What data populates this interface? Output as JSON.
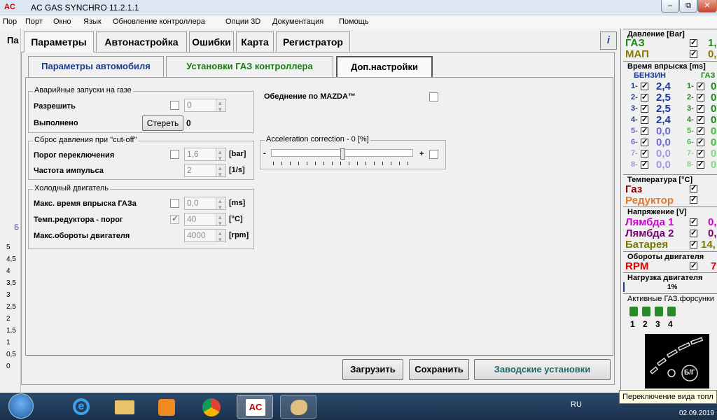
{
  "window": {
    "logo": "AC",
    "title": "AC GAS SYNCHRO  11.2.1.1",
    "controls": [
      "–",
      "⧉",
      "✕"
    ]
  },
  "menu": [
    "Пор",
    "Порт",
    "Окно",
    "Язык",
    "Обновление контроллера",
    "Опции 3D",
    "Документация",
    "Помощь"
  ],
  "left_strip": {
    "cut_label": "Па",
    "b_label": "Б",
    "y_ticks": [
      "5",
      "4,5",
      "4",
      "3,5",
      "3",
      "2,5",
      "2",
      "1,5",
      "1",
      "0,5",
      "0"
    ]
  },
  "tabs": [
    "Параметры",
    "Автонастройка",
    "Ошибки",
    "Карта",
    "Регистратор"
  ],
  "help_icon": "i",
  "subtabs": [
    "Параметры автомобиля",
    "Установки ГАЗ контроллера",
    "Доп.настройки"
  ],
  "groups": {
    "emergency": {
      "title": "Аварийные запуски на газе",
      "allow_label": "Разрешить",
      "allow_value": "0",
      "done_label": "Выполнено",
      "erase_btn": "Стереть",
      "done_value": "0"
    },
    "cutoff": {
      "title": "Сброс давления при \"cut-off\"",
      "threshold_label": "Порог переключения",
      "threshold_value": "1,6",
      "threshold_unit": "[bar]",
      "freq_label": "Частота импульса",
      "freq_value": "2",
      "freq_unit": "[1/s]"
    },
    "cold": {
      "title": "Холодный двигатель",
      "max_inj_label": "Макс. время впрыска ГАЗа",
      "max_inj_value": "0,0",
      "max_inj_unit": "[ms]",
      "red_temp_label": "Темп.редуктора - порог",
      "red_temp_value": "40",
      "red_temp_unit": "[°C]",
      "max_rpm_label": "Макс.обороты двигателя",
      "max_rpm_value": "4000",
      "max_rpm_unit": "[rpm]"
    },
    "mazda": {
      "label": "Обеднение по MAZDA™"
    },
    "accel": {
      "title": "Acceleration correction - 0 [%]",
      "minus": "-",
      "plus": "+",
      "level": 0.5
    }
  },
  "buttons": {
    "load": "Загрузить",
    "save": "Сохранить",
    "factory": "Заводские установки"
  },
  "right": {
    "pressure": {
      "header": "Давление [Bar]",
      "rows": [
        {
          "name": "ГАЗ",
          "value": "1,",
          "color": "#1a8a1a"
        },
        {
          "name": "МАП",
          "value": "0,",
          "color": "#8a7a00"
        }
      ]
    },
    "injection": {
      "header": "Время впрыска [ms]",
      "petrol_label": "БЕНЗИН",
      "gas_label": "ГАЗ",
      "rows": [
        {
          "n": "1-",
          "petrol": "2,4",
          "gas": "0"
        },
        {
          "n": "2-",
          "petrol": "2,5",
          "gas": "0"
        },
        {
          "n": "3-",
          "petrol": "2,5",
          "gas": "0"
        },
        {
          "n": "4-",
          "petrol": "2,4",
          "gas": "0"
        },
        {
          "n": "5-",
          "petrol": "0,0",
          "gas": "0"
        },
        {
          "n": "6-",
          "petrol": "0,0",
          "gas": "0"
        },
        {
          "n": "7-",
          "petrol": "0,0",
          "gas": "0"
        },
        {
          "n": "8-",
          "petrol": "0,0",
          "gas": "0"
        }
      ]
    },
    "temperature": {
      "header": "Температура [°C]",
      "rows": [
        {
          "name": "Газ",
          "color": "#8b0000"
        },
        {
          "name": "Редуктор",
          "color": "#e07a30"
        }
      ]
    },
    "voltage": {
      "header": "Напряжение [V]",
      "rows": [
        {
          "name": "Лямбда 1",
          "value": "0,",
          "color": "#d200d2"
        },
        {
          "name": "Лямбда 2",
          "value": "0,",
          "color": "#7a0070"
        },
        {
          "name": "Батарея",
          "value": "14,",
          "color": "#7a7a00"
        }
      ]
    },
    "rpm": {
      "header": "Обороты двигателя",
      "name": "RPM",
      "value": "7",
      "color": "#e00000"
    },
    "load": {
      "header": "Нагрузка двигателя",
      "value": "1%"
    },
    "injectors": {
      "header": "Активные ГАЗ.форсунки",
      "labels": [
        "1",
        "2",
        "3",
        "4"
      ]
    },
    "switch": {
      "label": "Б/Г"
    }
  },
  "tooltip": "Переключение вида топл",
  "taskbar": {
    "lang": "RU",
    "date": "02.09.2019"
  }
}
